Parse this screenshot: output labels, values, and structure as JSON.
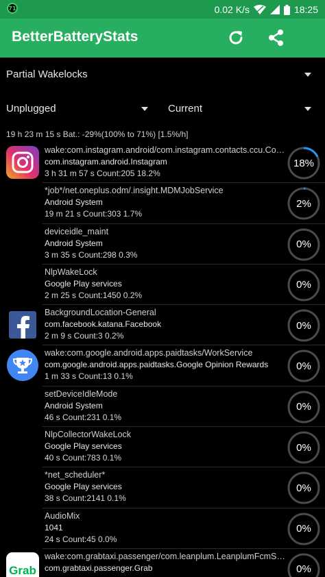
{
  "status_bar": {
    "badge": "71",
    "net_speed": "0.02 K/s",
    "time": "18:25"
  },
  "toolbar": {
    "title": "BetterBatteryStats",
    "refresh_icon": "refresh-icon",
    "share_icon": "share-icon"
  },
  "filters": {
    "stat_type": "Partial Wakelocks",
    "from": "Unplugged",
    "to": "Current"
  },
  "summary": "19 h 23 m 15 s  Bat.: -29%(100% to 71%) [1.5%/h]",
  "colors": {
    "status_bar": "#1e9a4f",
    "toolbar": "#27ae60",
    "ring_track": "#4a4a4a",
    "ring_fill": "#2196f3"
  },
  "wakelocks": [
    {
      "line1": "wake:com.instagram.android/com.instagram.contacts.ccu.Con...",
      "line2": "com.instagram.android.Instagram",
      "line3": "3 h 31 m 57 s Count:205 18.2%",
      "percent": "18%",
      "ratio": 0.182,
      "icon": "instagram-icon"
    },
    {
      "line1": "*job*/net.oneplus.odm/.insight.MDMJobService",
      "line2": "Android System",
      "line3": "19 m 21 s Count:303 1.7%",
      "percent": "2%",
      "ratio": 0.017,
      "icon": ""
    },
    {
      "line1": "deviceidle_maint",
      "line2": "Android System",
      "line3": "3 m 35 s Count:298 0.3%",
      "percent": "0%",
      "ratio": 0.003,
      "icon": ""
    },
    {
      "line1": "NlpWakeLock",
      "line2": "Google Play services",
      "line3": "2 m 25 s Count:1450 0.2%",
      "percent": "0%",
      "ratio": 0.002,
      "icon": ""
    },
    {
      "line1": "BackgroundLocation-General",
      "line2": "com.facebook.katana.Facebook",
      "line3": "2 m 9 s Count:3 0.2%",
      "percent": "0%",
      "ratio": 0.002,
      "icon": "facebook-icon"
    },
    {
      "line1": "wake:com.google.android.apps.paidtasks/WorkService",
      "line2": "com.google.android.apps.paidtasks.Google Opinion Rewards",
      "line3": "1 m 33 s Count:13 0.1%",
      "percent": "0%",
      "ratio": 0.001,
      "icon": "opinion-rewards-icon"
    },
    {
      "line1": "setDeviceIdleMode",
      "line2": "Android System",
      "line3": "46 s Count:231 0.1%",
      "percent": "0%",
      "ratio": 0.001,
      "icon": ""
    },
    {
      "line1": "NlpCollectorWakeLock",
      "line2": "Google Play services",
      "line3": "40 s Count:783 0.1%",
      "percent": "0%",
      "ratio": 0.001,
      "icon": ""
    },
    {
      "line1": "*net_scheduler*",
      "line2": "Google Play services",
      "line3": "38 s Count:2141 0.1%",
      "percent": "0%",
      "ratio": 0.001,
      "icon": ""
    },
    {
      "line1": "AudioMix",
      "line2": "1041",
      "line3": "24 s Count:45 0.0%",
      "percent": "0%",
      "ratio": 0.0,
      "icon": ""
    },
    {
      "line1": "wake:com.grabtaxi.passenger/com.leanplum.LeanplumFcmSer...",
      "line2": "com.grabtaxi.passenger.Grab",
      "line3": "",
      "percent": "0%",
      "ratio": 0.0,
      "icon": "grab-icon"
    }
  ]
}
